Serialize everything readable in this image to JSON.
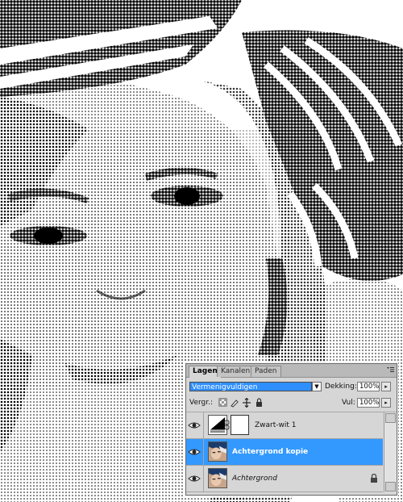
{
  "photo": {
    "description_icon": "halftone-portrait-photo"
  },
  "layers_panel": {
    "tabs": [
      {
        "label": "Lagen",
        "active": true
      },
      {
        "label": "Kanalen",
        "active": false
      },
      {
        "label": "Paden",
        "active": false
      }
    ],
    "blend_mode": "Vermenigvuldigen",
    "opacity_label": "Dekking:",
    "opacity_value": "100%",
    "lock_label": "Vergr.:",
    "fill_label": "Vul:",
    "fill_value": "100%",
    "layers": [
      {
        "name": "Zwart-wit 1",
        "type": "adjustment",
        "selected": false
      },
      {
        "name": "Achtergrond kopie",
        "type": "image",
        "selected": true
      },
      {
        "name": "Achtergrond",
        "type": "image",
        "selected": false,
        "locked": true
      }
    ],
    "colors": {
      "selection": "#3399ff",
      "panel_bg": "#d6d6d6"
    }
  }
}
